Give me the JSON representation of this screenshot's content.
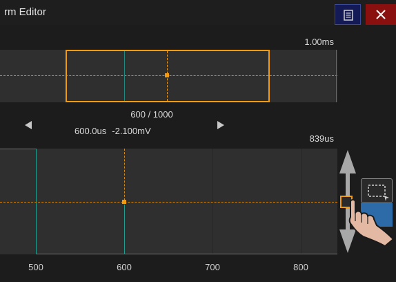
{
  "window": {
    "title": "rm Editor"
  },
  "overview": {
    "time_label": "1.00ms"
  },
  "position": {
    "count": "600 / 1000",
    "time": "600.0us",
    "voltage": "-2.100mV"
  },
  "zoom": {
    "time_label": "839us"
  },
  "x_axis": {
    "ticks": [
      "500",
      "600",
      "700",
      "800"
    ]
  },
  "colors": {
    "cursor": "#f29a10",
    "waveform": "#1f9e90",
    "close": "#8a1010",
    "menu": "#131a55",
    "active_tool": "#2d6aa8"
  },
  "icons": [
    "menu-icon",
    "close-icon",
    "left-arrow-icon",
    "right-arrow-icon",
    "double-arrow-icon",
    "selection-icon",
    "touch-hand-icon"
  ]
}
